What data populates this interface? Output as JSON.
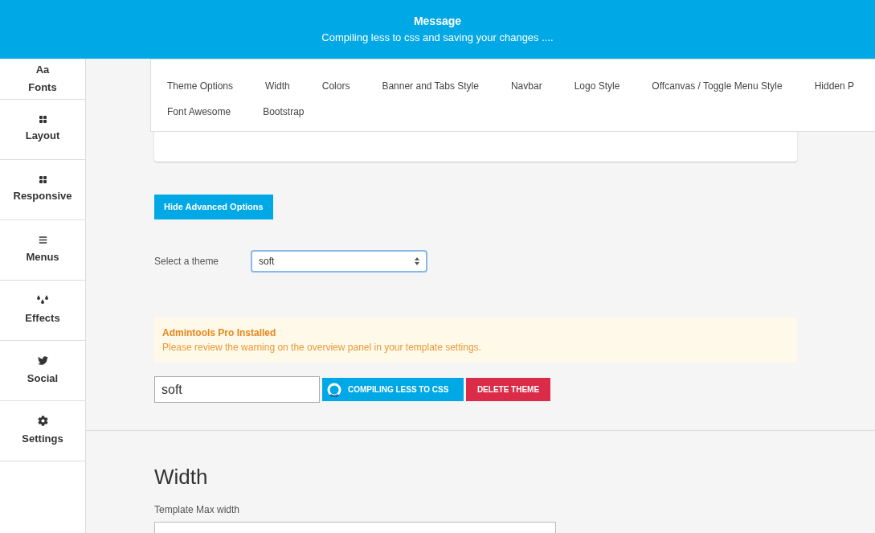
{
  "message": {
    "title": "Message",
    "text": "Compiling less to css and saving your changes ...."
  },
  "sidebar": {
    "items": [
      {
        "label": "Fonts",
        "glyph": "Aa"
      },
      {
        "label": "Layout"
      },
      {
        "label": "Responsive"
      },
      {
        "label": "Menus"
      },
      {
        "label": "Effects"
      },
      {
        "label": "Social"
      },
      {
        "label": "Settings"
      }
    ]
  },
  "nav": {
    "items": [
      "Theme Options",
      "Width",
      "Colors",
      "Banner and Tabs Style",
      "Navbar",
      "Logo Style",
      "Offcanvas / Toggle Menu Style",
      "Hidden P",
      "Font Awesome",
      "Bootstrap"
    ]
  },
  "advanced_button": "Hide Advanced Options",
  "theme_select": {
    "label": "Select a theme",
    "value": "soft"
  },
  "alert": {
    "title": "Admintools Pro Installed",
    "text": "Please review the warning on the overview panel in your template settings."
  },
  "theme_name": {
    "value": "soft"
  },
  "compile_button": "COMPILING LESS TO CSS",
  "delete_button": "DELETE THEME",
  "width_section": {
    "heading": "Width",
    "field_label": "Template Max width"
  }
}
